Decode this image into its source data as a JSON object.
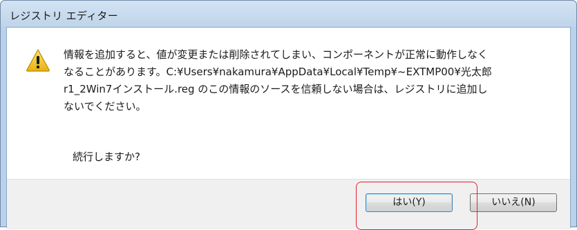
{
  "window": {
    "title": "レジストリ エディター"
  },
  "dialog": {
    "icon": "warning-icon",
    "message": "情報を追加すると、値が変更または削除されてしまい、コンポーネントが正常に動作しなく\nなることがあります。C:¥Users¥nakamura¥AppData¥Local¥Temp¥~EXTMP00¥光太郎\nr1_2Win7インストール.reg のこの情報のソースを信頼しない場合は、レジストリに追加し\nないでください。",
    "question": "続行しますか?",
    "buttons": {
      "yes_label": "はい(Y)",
      "no_label": "いいえ(N)"
    }
  },
  "annotation": {
    "highlight_color": "#e0202e"
  },
  "colors": {
    "frame": "#b9d1ea",
    "footer": "#f0f0f0",
    "warning": "#f2c81e"
  }
}
